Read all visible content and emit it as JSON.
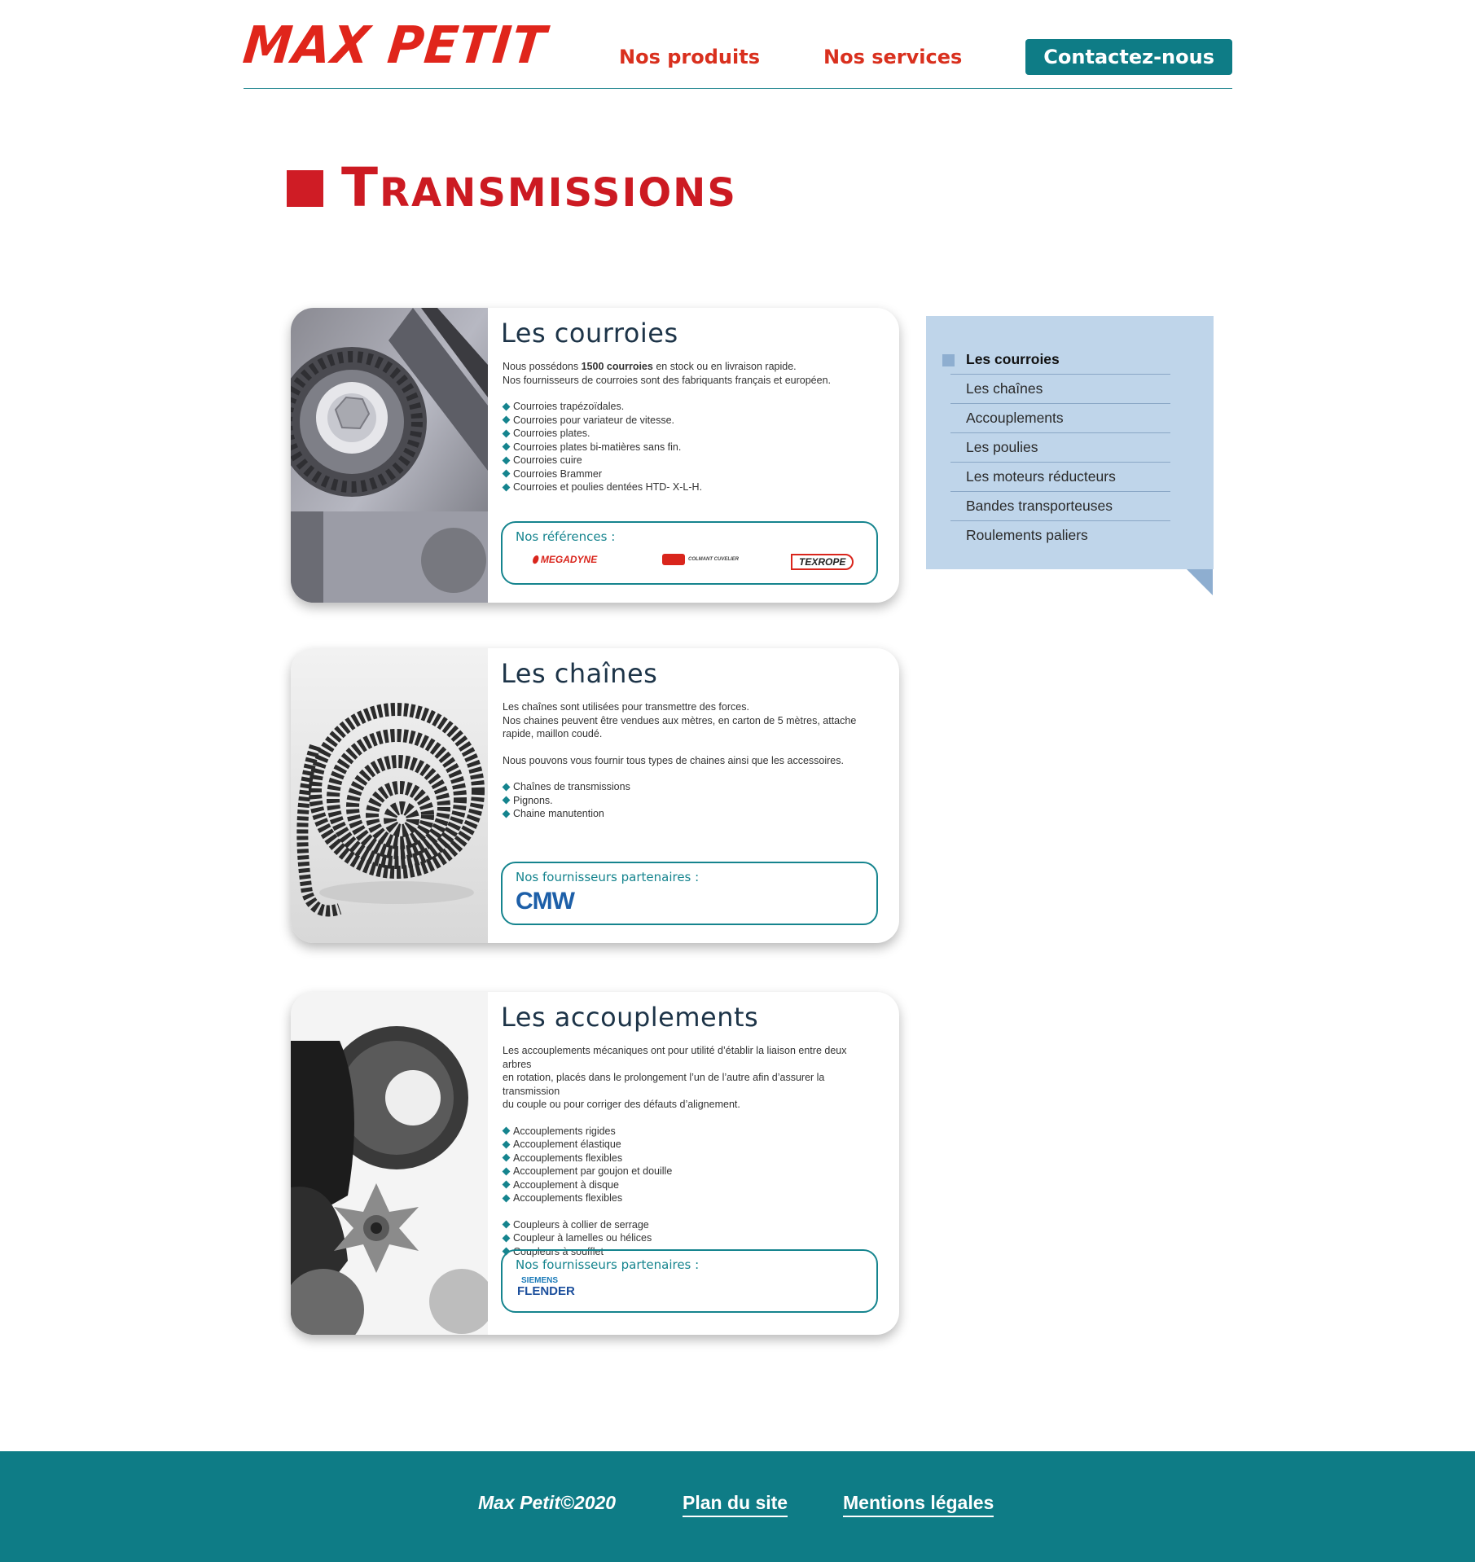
{
  "header": {
    "logo": "MAX PETIT",
    "nav": [
      "Nos produits",
      "Nos services"
    ],
    "cta": "Contactez-nous"
  },
  "page": {
    "title_first": "T",
    "title_rest": "RANSMISSIONS"
  },
  "cards": [
    {
      "title": "Les courroies",
      "intro_before": "Nous possédons ",
      "intro_bold": "1500 courroies",
      "intro_after": " en stock ou en livraison rapide.",
      "intro_line2": "Nos fournisseurs de courroies  sont des fabriquants français et européen.",
      "bullets": [
        "Courroies trapézoïdales.",
        "Courroies pour variateur de vitesse.",
        "Courroies plates.",
        "Courroies plates bi-matières sans fin.",
        "Courroies cuire",
        "Courroies Brammer",
        "Courroies et poulies dentées HTD- X-L-H."
      ],
      "refs_title": "Nos références :",
      "ref_logos": [
        "MEGADYNE",
        "COLMANT CUVELIER",
        "TEXROPE"
      ]
    },
    {
      "title": "Les chaînes",
      "para1": "Les chaînes sont utilisées pour transmettre des forces.",
      "para2": "Nos chaines peuvent être vendues aux mètres, en carton de 5 mètres, attache",
      "para3": "rapide, maillon coudé.",
      "para4": "Nous pouvons vous fournir tous types de chaines ainsi que les accessoires.",
      "bullets": [
        "Chaînes de transmissions",
        "Pignons.",
        "Chaine manutention"
      ],
      "refs_title": "Nos fournisseurs partenaires :",
      "ref_logo": "CMW"
    },
    {
      "title": "Les accouplements",
      "para1": "Les accouplements mécaniques ont pour utilité d’établir la liaison entre deux arbres",
      "para2": "en rotation, placés dans le prolongement l’un de l’autre afin d’assurer la transmission",
      "para3": "du couple ou pour corriger des défauts d’alignement.",
      "bullets": [
        "Accouplements rigides",
        "Accouplement élastique",
        "Accouplements flexibles",
        "Accouplement par goujon et douille",
        "Accouplement à disque",
        "Accouplements flexibles"
      ],
      "bullets2": [
        "Coupleurs à collier de serrage",
        "Coupleur à lamelles ou hélices",
        "Coupleurs à soufflet"
      ],
      "refs_title": "Nos fournisseurs partenaires :",
      "ref_logo_top": "SIEMENS",
      "ref_logo_bottom": "FLENDER"
    }
  ],
  "sidebar": {
    "items": [
      "Les courroies",
      "Les chaînes",
      "Accouplements",
      "Les poulies",
      "Les moteurs réducteurs",
      "Bandes transporteuses",
      "Roulements paliers"
    ],
    "active_index": 0
  },
  "footer": {
    "copyright": "Max Petit©2020",
    "links": [
      "Plan du site",
      "Mentions légales"
    ]
  },
  "colors": {
    "brand_red": "#e0251b",
    "teal": "#0e7c86",
    "sidebar_bg": "#bfd5ea",
    "title_navy": "#1d3448"
  }
}
